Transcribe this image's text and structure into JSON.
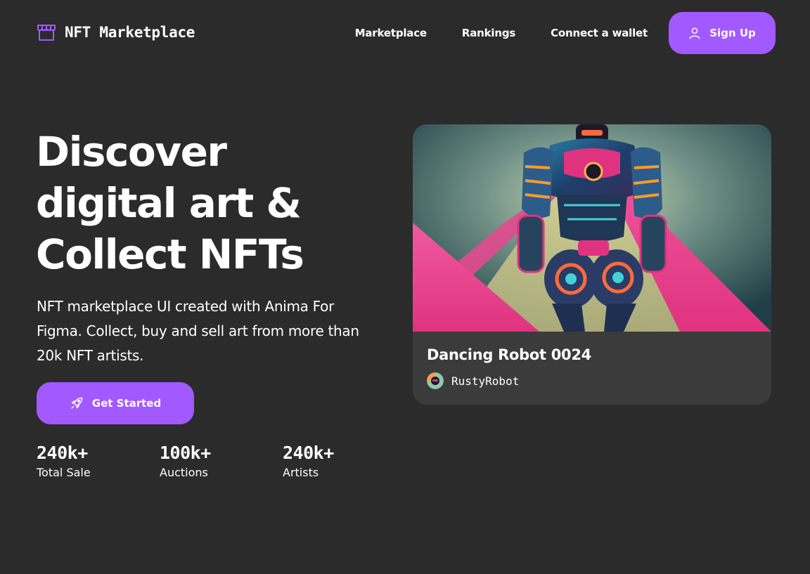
{
  "header": {
    "logo_text": "NFT Marketplace",
    "logo_icon": "storefront-icon",
    "nav": [
      {
        "label": "Marketplace"
      },
      {
        "label": "Rankings"
      },
      {
        "label": "Connect a wallet"
      }
    ],
    "signup_label": "Sign Up",
    "signup_icon": "user-icon"
  },
  "hero": {
    "title_lines": [
      "Discover",
      "digital art &",
      "Collect NFTs"
    ],
    "subtitle": "NFT marketplace UI created with Anima For Figma. Collect, buy and sell art from more than 20k NFT artists.",
    "cta_label": "Get Started",
    "cta_icon": "rocket-icon",
    "stats": [
      {
        "value": "240k+",
        "label": "Total Sale"
      },
      {
        "value": "100k+",
        "label": "Auctions"
      },
      {
        "value": "240k+",
        "label": "Artists"
      }
    ]
  },
  "featured": {
    "title": "Dancing Robot 0024",
    "artist": "RustyRobot"
  },
  "colors": {
    "background": "#2b2b2b",
    "card": "#3b3b3b",
    "accent": "#a259ff",
    "text": "#ffffff"
  }
}
